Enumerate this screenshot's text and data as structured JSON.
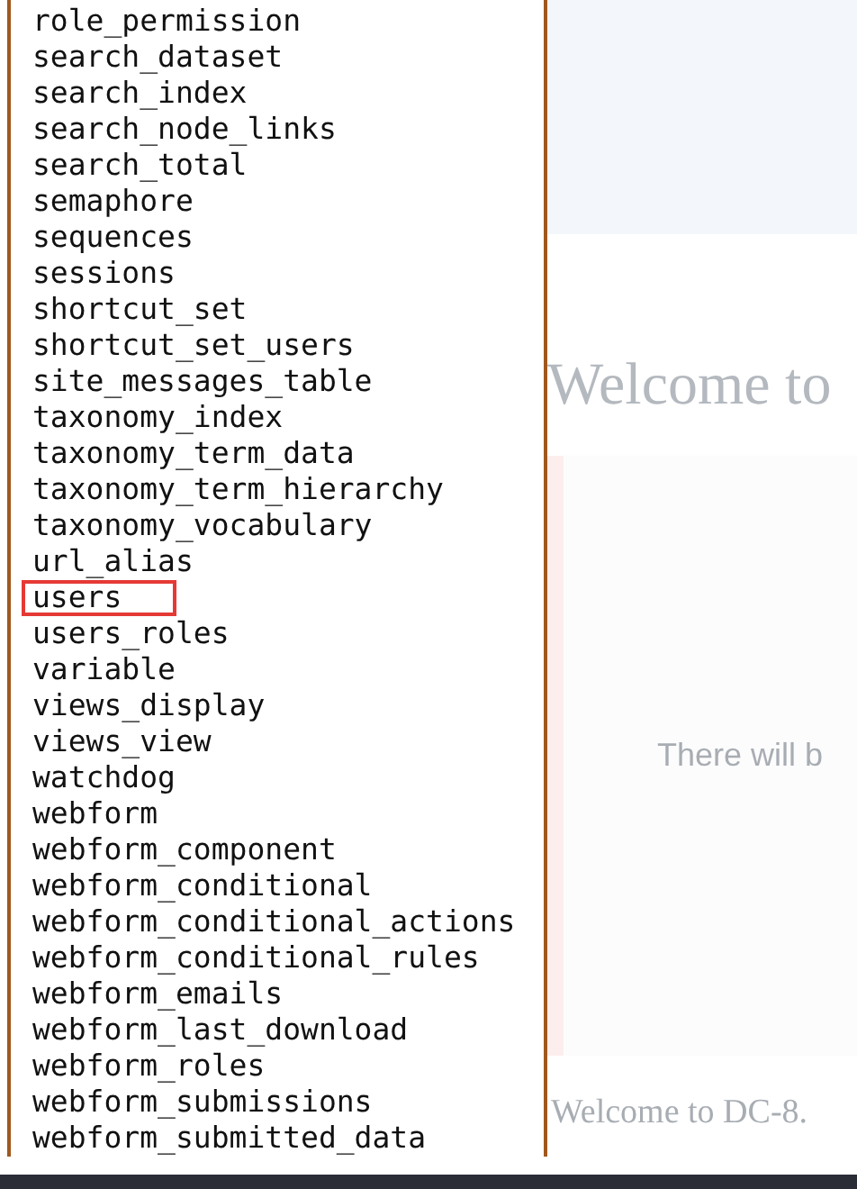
{
  "table_list": [
    {
      "name": "role_permission",
      "selected": false
    },
    {
      "name": "search_dataset",
      "selected": false
    },
    {
      "name": "search_index",
      "selected": false
    },
    {
      "name": "search_node_links",
      "selected": false
    },
    {
      "name": "search_total",
      "selected": false
    },
    {
      "name": "semaphore",
      "selected": false
    },
    {
      "name": "sequences",
      "selected": false
    },
    {
      "name": "sessions",
      "selected": false
    },
    {
      "name": "shortcut_set",
      "selected": false
    },
    {
      "name": "shortcut_set_users",
      "selected": false
    },
    {
      "name": "site_messages_table",
      "selected": false
    },
    {
      "name": "taxonomy_index",
      "selected": false
    },
    {
      "name": "taxonomy_term_data",
      "selected": false
    },
    {
      "name": "taxonomy_term_hierarchy",
      "selected": false
    },
    {
      "name": "taxonomy_vocabulary",
      "selected": false
    },
    {
      "name": "url_alias",
      "selected": false
    },
    {
      "name": "users",
      "selected": true
    },
    {
      "name": "users_roles",
      "selected": false
    },
    {
      "name": "variable",
      "selected": false
    },
    {
      "name": "views_display",
      "selected": false
    },
    {
      "name": "views_view",
      "selected": false
    },
    {
      "name": "watchdog",
      "selected": false
    },
    {
      "name": "webform",
      "selected": false
    },
    {
      "name": "webform_component",
      "selected": false
    },
    {
      "name": "webform_conditional",
      "selected": false
    },
    {
      "name": "webform_conditional_actions",
      "selected": false
    },
    {
      "name": "webform_conditional_rules",
      "selected": false
    },
    {
      "name": "webform_emails",
      "selected": false
    },
    {
      "name": "webform_last_download",
      "selected": false
    },
    {
      "name": "webform_roles",
      "selected": false
    },
    {
      "name": "webform_submissions",
      "selected": false
    },
    {
      "name": "webform_submitted_data",
      "selected": false
    }
  ],
  "page": {
    "heading": "Welcome to",
    "box_text": "There will b",
    "footer_text": "Welcome to DC-8."
  }
}
